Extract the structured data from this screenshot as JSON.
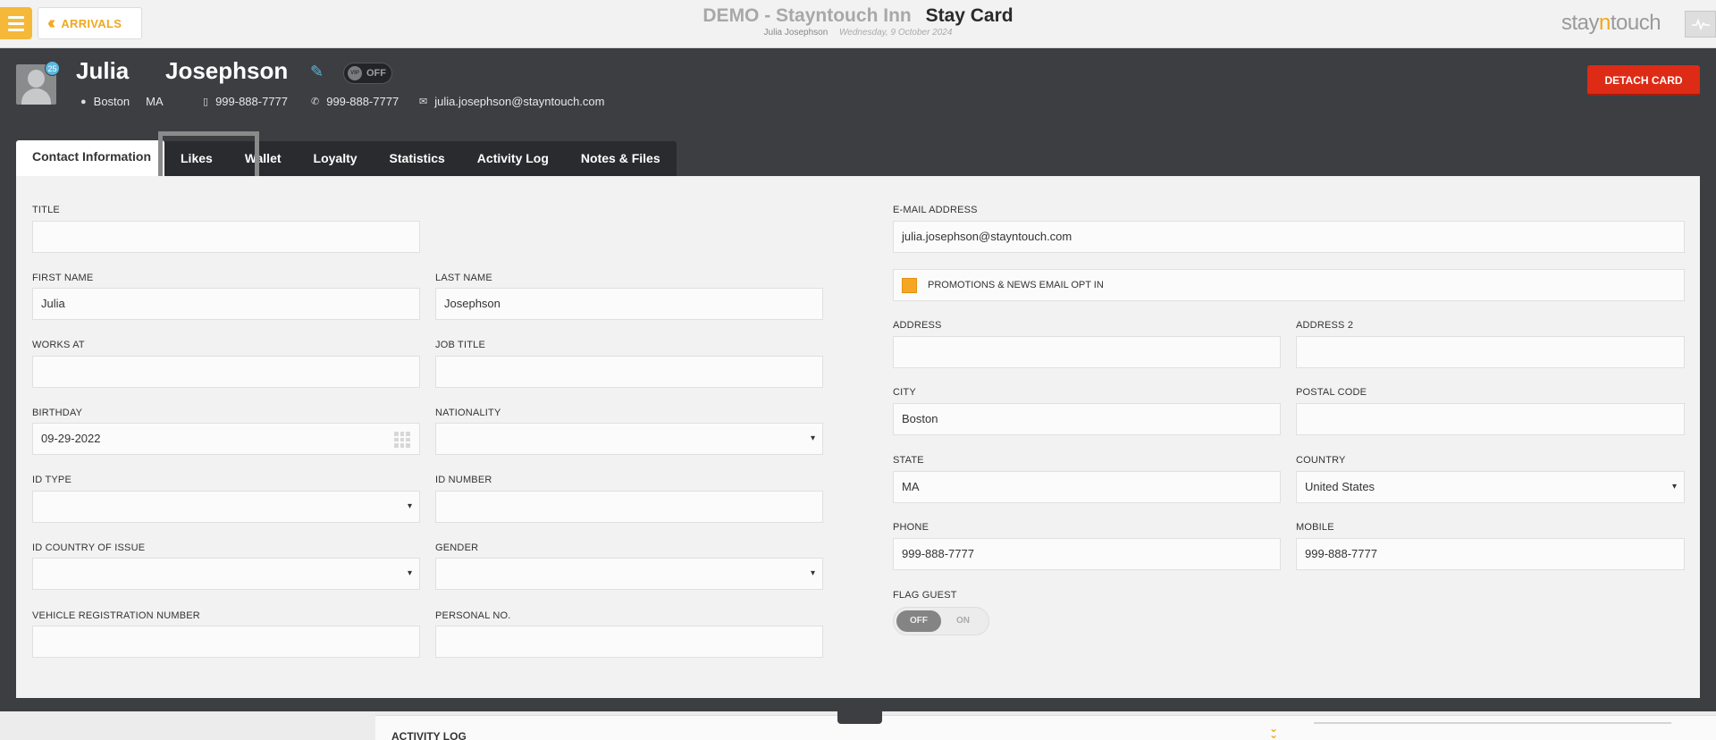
{
  "topbar": {
    "back_label": "ARRIVALS",
    "title_prefix": "DEMO - Stayntouch Inn",
    "title": "Stay Card",
    "guest_name": "Julia Josephson",
    "date": "Wednesday, 9 October 2024",
    "brand_left": "stay",
    "brand_mid": "n",
    "brand_right": "touch"
  },
  "guest": {
    "first_name": "Julia",
    "last_name": "Josephson",
    "stay_count": "25",
    "vip_badge": "VIP",
    "vip_state": "OFF",
    "city": "Boston",
    "state": "MA",
    "mobile": "999-888-7777",
    "phone": "999-888-7777",
    "email": "julia.josephson@stayntouch.com",
    "detach_label": "DETACH CARD"
  },
  "tabs": {
    "active": "Contact Information",
    "items": [
      "Likes",
      "Wallet",
      "Loyalty",
      "Statistics",
      "Activity Log",
      "Notes & Files"
    ]
  },
  "form": {
    "labels": {
      "title": "TITLE",
      "first_name": "FIRST NAME",
      "last_name": "LAST NAME",
      "works_at": "WORKS AT",
      "job_title": "JOB TITLE",
      "birthday": "BIRTHDAY",
      "nationality": "NATIONALITY",
      "id_type": "ID TYPE",
      "id_number": "ID NUMBER",
      "id_country": "ID COUNTRY OF ISSUE",
      "gender": "GENDER",
      "vehicle": "VEHICLE REGISTRATION NUMBER",
      "personal_no": "PERSONAL NO.",
      "email": "E-MAIL ADDRESS",
      "address": "ADDRESS",
      "address2": "ADDRESS 2",
      "city": "CITY",
      "postal_code": "POSTAL CODE",
      "state": "STATE",
      "country": "COUNTRY",
      "phone": "PHONE",
      "mobile": "MOBILE",
      "flag_guest": "FLAG GUEST"
    },
    "values": {
      "title": "",
      "first_name": "Julia",
      "last_name": "Josephson",
      "works_at": "",
      "job_title": "",
      "birthday": "09-29-2022",
      "nationality": "",
      "id_type": "",
      "id_number": "",
      "id_country": "",
      "gender": "",
      "vehicle": "",
      "personal_no": "",
      "email": "julia.josephson@stayntouch.com",
      "address": "",
      "address2": "",
      "city": "Boston",
      "postal_code": "",
      "state": "MA",
      "country": "United States",
      "phone": "999-888-7777",
      "mobile": "999-888-7777"
    },
    "promo_label": "PROMOTIONS & NEWS EMAIL OPT IN",
    "flag_off": "OFF",
    "flag_on": "ON"
  },
  "bottom": {
    "activity_label": "ACTIVITY LOG"
  },
  "colors": {
    "accent": "#f0a81d",
    "danger": "#dd2b16",
    "header_bg": "#3d3e42"
  }
}
